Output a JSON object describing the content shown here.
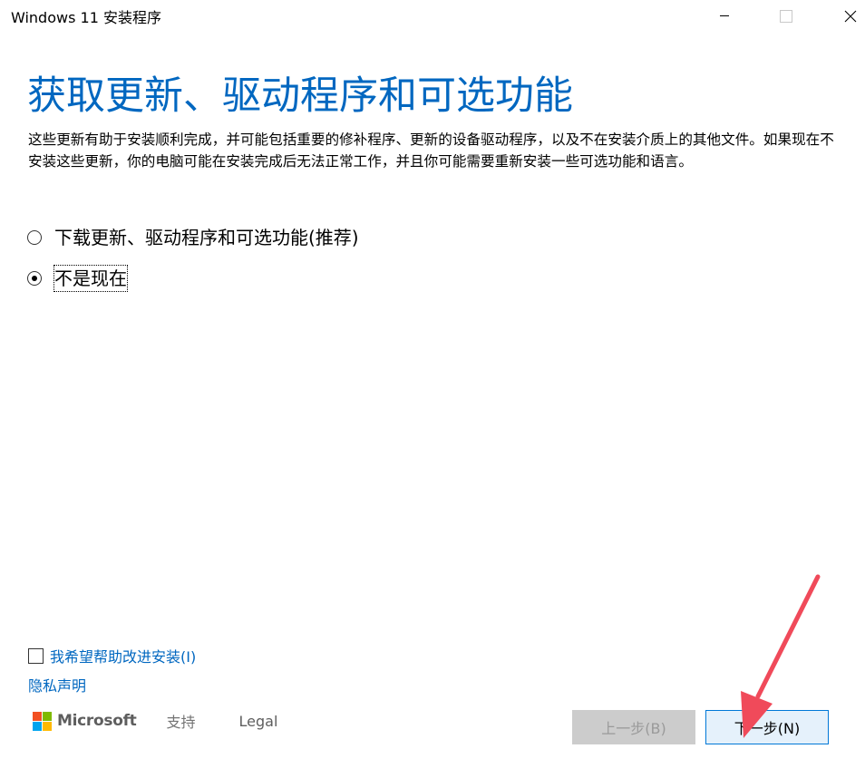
{
  "window": {
    "title": "Windows 11 安装程序",
    "controls": {
      "minimize_icon": "minimize-icon",
      "maximize_icon": "maximize-icon",
      "close_icon": "close-icon"
    }
  },
  "page": {
    "heading": "获取更新、驱动程序和可选功能",
    "description": "这些更新有助于安装顺利完成，并可能包括重要的修补程序、更新的设备驱动程序，以及不在安装介质上的其他文件。如果现在不安装这些更新，你的电脑可能在安装完成后无法正常工作，并且你可能需要重新安装一些可选功能和语言。"
  },
  "options": [
    {
      "label": "下载更新、驱动程序和可选功能(推荐)",
      "selected": false
    },
    {
      "label": "不是现在",
      "selected": true
    }
  ],
  "improve": {
    "label": "我希望帮助改进安装(I)",
    "checked": false
  },
  "privacy_link": "隐私声明",
  "footer": {
    "brand": "Microsoft",
    "support": "支持",
    "legal": "Legal"
  },
  "buttons": {
    "back": "上一步(B)",
    "next": "下一步(N)"
  },
  "colors": {
    "accent": "#0067c0",
    "ms_red": "#f25022",
    "ms_green": "#7fba00",
    "ms_blue": "#00a4ef",
    "ms_yellow": "#ffb900",
    "annotation_arrow": "#f04a5a"
  }
}
